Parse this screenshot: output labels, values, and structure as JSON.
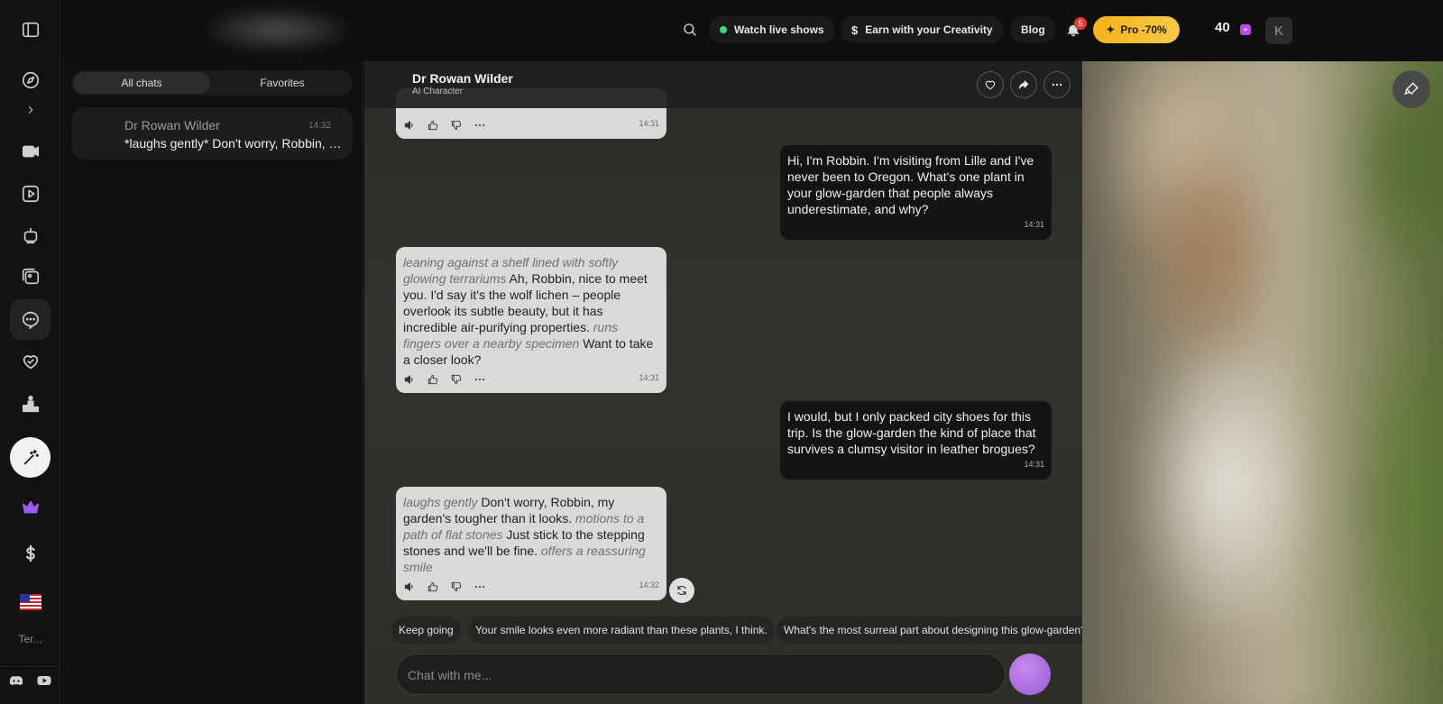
{
  "nav": {
    "terms_label": "Ter...",
    "items": [
      "sidebar-toggle-icon",
      "compass-icon",
      "chevron-right-icon",
      "video-icon",
      "play-icon",
      "robot-icon",
      "gallery-icon",
      "chat-icon",
      "heart-handshake-icon",
      "leaderboard-icon",
      "magic-wand-icon",
      "crown-icon",
      "dollar-icon",
      "us-flag-icon"
    ]
  },
  "topbar": {
    "watch_live": "Watch live shows",
    "earn": "Earn with your Creativity",
    "blog": "Blog",
    "notifications_count": "5",
    "pro_label": "Pro -70%",
    "credits": "40",
    "avatar_initial": "K",
    "accent_color": "#f5b21a"
  },
  "chat_list": {
    "tabs": [
      "All chats",
      "Favorites"
    ],
    "active_tab": "All chats",
    "items": [
      {
        "name": "Dr Rowan Wilder",
        "time": "14:32",
        "preview": "*laughs gently* Don't worry, Robbin, my garden's tougher than it looks."
      }
    ]
  },
  "conversation": {
    "character_name": "Dr Rowan Wilder",
    "character_subtitle": "AI Character",
    "messages": [
      {
        "role": "bot",
        "time": "14:31",
        "parts": []
      },
      {
        "role": "user",
        "time": "14:31",
        "text": "Hi, I'm Robbin. I'm visiting from Lille and I've never been to Oregon. What's one plant in your glow-garden that people always underestimate, and why?"
      },
      {
        "role": "bot",
        "time": "14:31",
        "parts": [
          {
            "type": "action",
            "text": "leaning against a shelf lined with softly glowing terrariums"
          },
          {
            "type": "text",
            "text": " Ah, Robbin, nice to meet you. I'd say it's the wolf lichen – people overlook its subtle beauty, but it has incredible air-purifying properties. "
          },
          {
            "type": "action",
            "text": "runs fingers over a nearby specimen"
          },
          {
            "type": "text",
            "text": " Want to take a closer look?"
          }
        ]
      },
      {
        "role": "user",
        "time": "14:31",
        "text": "I would, but I only packed city shoes for this trip. Is the glow-garden the kind of place that survives a clumsy visitor in leather brogues?"
      },
      {
        "role": "bot",
        "time": "14:32",
        "parts": [
          {
            "type": "action",
            "text": "laughs gently"
          },
          {
            "type": "text",
            "text": " Don't worry, Robbin, my garden's tougher than it looks. "
          },
          {
            "type": "action",
            "text": "motions to a path of flat stones"
          },
          {
            "type": "text",
            "text": " Just stick to the stepping stones and we'll be fine. "
          },
          {
            "type": "action",
            "text": "offers a reassuring smile"
          }
        ]
      }
    ],
    "suggestions": [
      "Keep going",
      "Your smile looks even more radiant than these plants, I think.",
      "What's the most surreal part about designing this glow-garden?"
    ],
    "input_placeholder": "Chat with me..."
  }
}
